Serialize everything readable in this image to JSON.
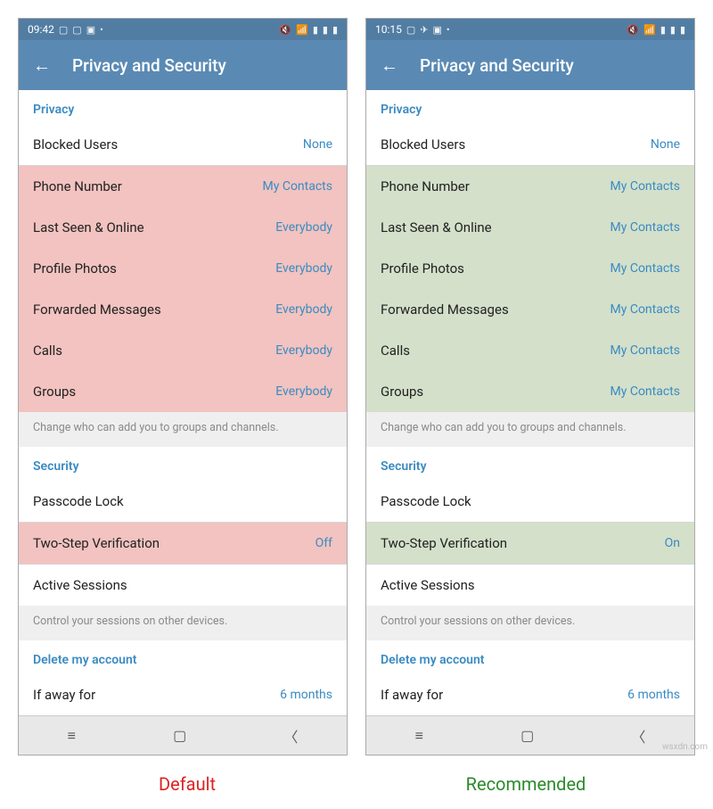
{
  "left": {
    "statusbar": {
      "time": "09:42"
    },
    "title": "Privacy and Security",
    "privacy_header": "Privacy",
    "blocked_label": "Blocked Users",
    "blocked_value": "None",
    "rows": [
      {
        "label": "Phone Number",
        "value": "My Contacts"
      },
      {
        "label": "Last Seen & Online",
        "value": "Everybody"
      },
      {
        "label": "Profile Photos",
        "value": "Everybody"
      },
      {
        "label": "Forwarded Messages",
        "value": "Everybody"
      },
      {
        "label": "Calls",
        "value": "Everybody"
      },
      {
        "label": "Groups",
        "value": "Everybody"
      }
    ],
    "groups_hint": "Change who can add you to groups and channels.",
    "security_header": "Security",
    "passcode_label": "Passcode Lock",
    "twostep_label": "Two-Step Verification",
    "twostep_value": "Off",
    "sessions_label": "Active Sessions",
    "sessions_hint": "Control your sessions on other devices.",
    "delete_header": "Delete my account",
    "away_label": "If away for",
    "away_value": "6 months",
    "caption": "Default"
  },
  "right": {
    "statusbar": {
      "time": "10:15"
    },
    "title": "Privacy and Security",
    "privacy_header": "Privacy",
    "blocked_label": "Blocked Users",
    "blocked_value": "None",
    "rows": [
      {
        "label": "Phone Number",
        "value": "My Contacts"
      },
      {
        "label": "Last Seen & Online",
        "value": "My Contacts"
      },
      {
        "label": "Profile Photos",
        "value": "My Contacts"
      },
      {
        "label": "Forwarded Messages",
        "value": "My Contacts"
      },
      {
        "label": "Calls",
        "value": "My Contacts"
      },
      {
        "label": "Groups",
        "value": "My Contacts"
      }
    ],
    "groups_hint": "Change who can add you to groups and channels.",
    "security_header": "Security",
    "passcode_label": "Passcode Lock",
    "twostep_label": "Two-Step Verification",
    "twostep_value": "On",
    "sessions_label": "Active Sessions",
    "sessions_hint": "Control your sessions on other devices.",
    "delete_header": "Delete my account",
    "away_label": "If away for",
    "away_value": "6 months",
    "caption": "Recommended"
  },
  "watermark": "wsxdn.com"
}
